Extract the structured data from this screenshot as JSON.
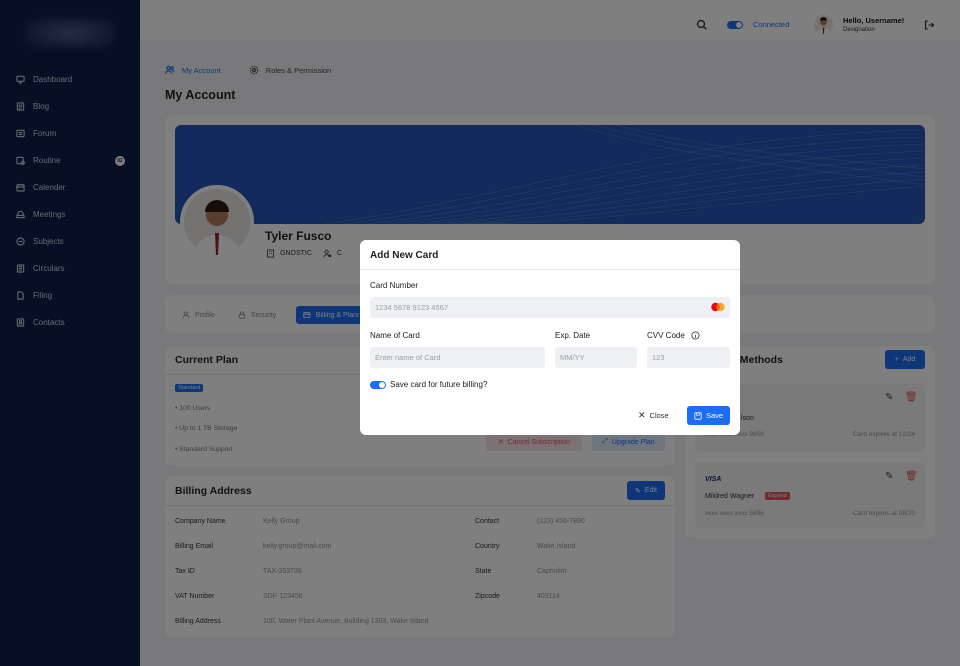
{
  "colors": {
    "sidebar": "#0f1f4a",
    "accent": "#1b6ef3",
    "danger": "#e0525e"
  },
  "sidebar": {
    "items": [
      {
        "label": "Dashboard",
        "icon": "monitor-icon"
      },
      {
        "label": "Blog",
        "icon": "blog-icon"
      },
      {
        "label": "Forum",
        "icon": "forum-icon"
      },
      {
        "label": "Routine",
        "icon": "routine-icon",
        "badge": "02"
      },
      {
        "label": "Calender",
        "icon": "calendar-icon"
      },
      {
        "label": "Meetings",
        "icon": "meetings-icon"
      },
      {
        "label": "Subjects",
        "icon": "subjects-icon"
      },
      {
        "label": "Circulars",
        "icon": "circulars-icon"
      },
      {
        "label": "Filing",
        "icon": "file-icon"
      },
      {
        "label": "Contacts",
        "icon": "contacts-icon"
      }
    ]
  },
  "topbar": {
    "status": "Connected",
    "greeting": "Hello, Username!",
    "designation": "Designation"
  },
  "tabs": {
    "my_account": "My Account",
    "roles": "Roles & Permission"
  },
  "page_title": "My Account",
  "profile": {
    "name": "Tyler Fusco",
    "org": "GNOSTIC",
    "role_initial": "C"
  },
  "subtabs": {
    "profile": "Profile",
    "security": "Security",
    "billing": "Billing & Plans"
  },
  "plan": {
    "title": "Current Plan",
    "badge": "Standard",
    "features": [
      "100 Users",
      "Up to 1 TB Storage",
      "Standard Support"
    ],
    "cancel": "Cancel Subscription",
    "upgrade": "Upgrade Plan"
  },
  "billing": {
    "title": "Billing Address",
    "edit": "Edit",
    "rows": [
      {
        "label": "Company Name",
        "value": "Kelly Group"
      },
      {
        "label": "Billing Email",
        "value": "kelly.group@mail.com"
      },
      {
        "label": "Tax ID",
        "value": "TAX-353738"
      },
      {
        "label": "VAT Number",
        "value": "SDF-123456"
      },
      {
        "label": "Billing Address",
        "value": "100, Water Plant Avenue, Building 1303, Wake Island"
      }
    ],
    "rows_right": [
      {
        "label": "Contact",
        "value": "(123) 456-7890"
      },
      {
        "label": "Country",
        "value": "Wake Island"
      },
      {
        "label": "State",
        "value": "Capholim"
      },
      {
        "label": "Zipcode",
        "value": "403114"
      }
    ]
  },
  "methods": {
    "title": "c Methods",
    "add": "Add",
    "cards": [
      {
        "holder": "lson",
        "number": "xxxx xxxx xxxx 9856",
        "expiry": "Card expires at 12/24"
      },
      {
        "brand": "VISA",
        "holder": "Mildred Wagner",
        "status": "Expired",
        "number": "xxxx xxxx xxxx 5896",
        "expiry": "Card expires at 08/20"
      }
    ]
  },
  "modal": {
    "title": "Add New Card",
    "card_number_label": "Card Number",
    "card_number_placeholder": "1234 5678 9123 4567",
    "name_label": "Name of Card",
    "name_placeholder": "Enter name of Card",
    "exp_label": "Exp. Date",
    "exp_placeholder": "MM/YY",
    "cvv_label": "CVV Code",
    "cvv_placeholder": "123",
    "save_card_label": "Save card for future billing?",
    "close": "Close",
    "save": "Save"
  }
}
